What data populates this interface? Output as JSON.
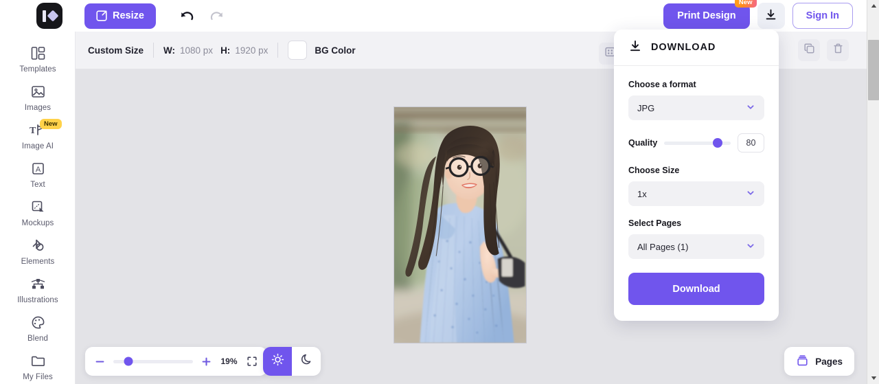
{
  "topbar": {
    "logo_name": "photo-editor-logo",
    "resize_label": "Resize",
    "undo_name": "undo-icon",
    "redo_name": "redo-icon",
    "print_design_label": "Print Design",
    "print_design_badge": "New",
    "download_icon_name": "download-icon",
    "sign_in_label": "Sign In"
  },
  "sidebar": {
    "items": [
      {
        "label": "Templates",
        "icon": "templates-icon",
        "badge": ""
      },
      {
        "label": "Images",
        "icon": "images-icon",
        "badge": ""
      },
      {
        "label": "Image AI",
        "icon": "image-ai-icon",
        "badge": "New"
      },
      {
        "label": "Text",
        "icon": "text-icon",
        "badge": ""
      },
      {
        "label": "Mockups",
        "icon": "mockups-icon",
        "badge": ""
      },
      {
        "label": "Elements",
        "icon": "elements-icon",
        "badge": ""
      },
      {
        "label": "Illustrations",
        "icon": "illustrations-icon",
        "badge": ""
      },
      {
        "label": "Blend",
        "icon": "blend-icon",
        "badge": ""
      },
      {
        "label": "My Files",
        "icon": "my-files-icon",
        "badge": ""
      }
    ]
  },
  "toolbar": {
    "custom_size_label": "Custom Size",
    "width_label": "W:",
    "width_value": "1080 px",
    "height_label": "H:",
    "height_value": "1920 px",
    "bg_color_label": "BG Color",
    "bg_color_value": "#ffffff",
    "position_icon": "position-grid-icon",
    "duplicate_icon": "duplicate-icon",
    "delete_icon": "trash-icon"
  },
  "canvas": {
    "artboard_name": "artboard",
    "image_alt": "portrait-photo-woman-blue-dress-glasses"
  },
  "bottombar": {
    "zoom_out_icon": "minus-icon",
    "zoom_in_icon": "plus-icon",
    "zoom_value": "19%",
    "zoom_percent": 19,
    "fit_icon": "fit-to-screen-icon",
    "light_mode_icon": "sun-icon",
    "dark_mode_icon": "moon-icon",
    "active_theme": "light",
    "pages_label": "Pages",
    "pages_icon": "pages-stack-icon"
  },
  "download_panel": {
    "title": "DOWNLOAD",
    "header_icon": "download-icon",
    "format_label": "Choose a format",
    "format_value": "JPG",
    "quality_label": "Quality",
    "quality_value": "80",
    "quality_percent": 80,
    "size_label": "Choose Size",
    "size_value": "1x",
    "pages_label": "Select Pages",
    "pages_value": "All Pages (1)",
    "submit_label": "Download"
  },
  "colors": {
    "accent": "#7055ed",
    "badge_new_sidebar": "#ffd24a",
    "canvas_bg": "#e3e3e7",
    "toolbar_bg": "#f2f2f5"
  }
}
